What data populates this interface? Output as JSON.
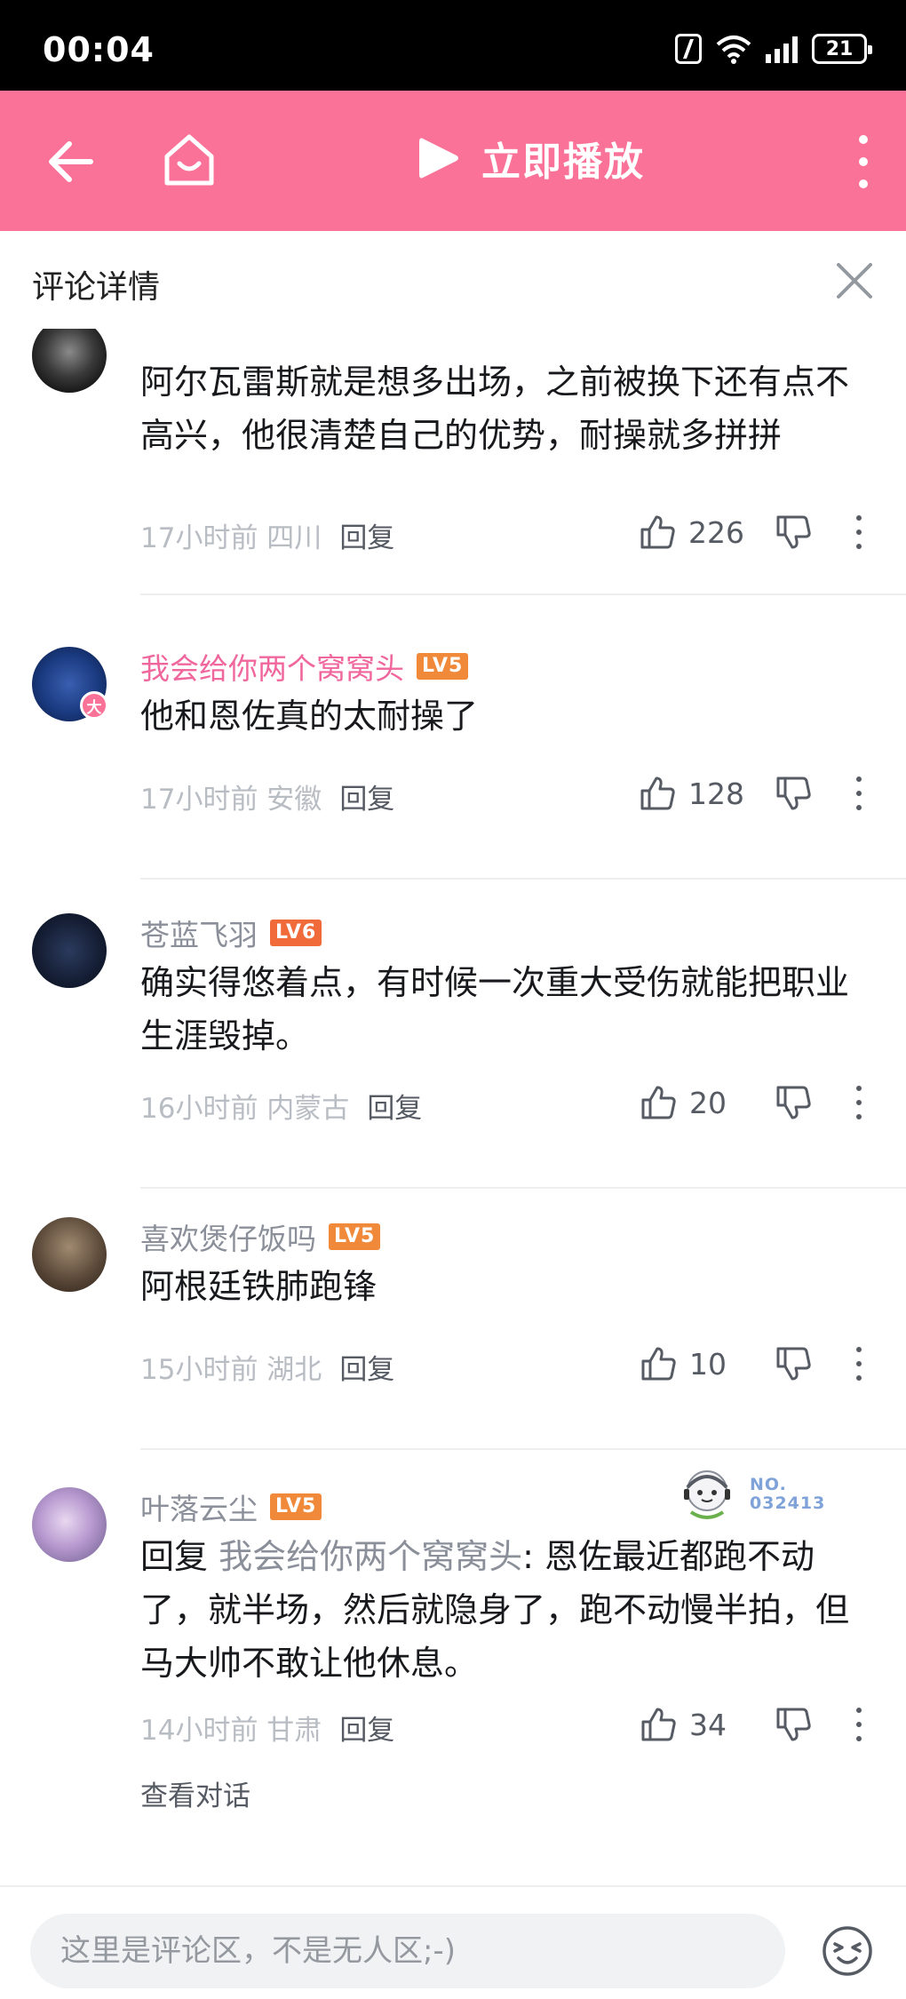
{
  "status_bar": {
    "time": "00:04",
    "battery": "21"
  },
  "header": {
    "play_now": "立即播放"
  },
  "panel": {
    "title": "评论详情"
  },
  "comments": [
    {
      "username": "",
      "text": "阿尔瓦雷斯就是想多出场，之前被换下还有点不高兴，他很清楚自己的优势，耐操就多拼拼",
      "time_loc": "17小时前 四川",
      "reply": "回复",
      "likes": "226"
    },
    {
      "username": "我会给你两个窝窝头",
      "level": "LV5",
      "fan_badge": "大",
      "text": "他和恩佐真的太耐操了",
      "time_loc": "17小时前 安徽",
      "reply": "回复",
      "likes": "128"
    },
    {
      "username": "苍蓝飞羽",
      "level": "LV6",
      "text": "确实得悠着点，有时候一次重大受伤就能把职业生涯毁掉。",
      "time_loc": "16小时前 内蒙古",
      "reply": "回复",
      "likes": "20"
    },
    {
      "username": "喜欢煲仔饭吗",
      "level": "LV5",
      "text": "阿根廷铁肺跑锋",
      "time_loc": "15小时前 湖北",
      "reply": "回复",
      "likes": "10"
    },
    {
      "username": "叶落云尘",
      "level": "LV5",
      "no_card": [
        "NO.",
        "032413"
      ],
      "reply_prefix": "回复 ",
      "reply_to": "我会给你两个窝窝头",
      "text": ": 恩佐最近都跑不动了，就半场，然后就隐身了，跑不动慢半拍，但马大帅不敢让他休息。",
      "time_loc": "14小时前 甘肃",
      "reply": "回复",
      "likes": "34",
      "view_thread": "查看对话"
    }
  ],
  "bottom": {
    "placeholder": "这里是评论区，不是无人区;-)"
  },
  "colors": {
    "brand_pink": "#fb7299",
    "username_gray": "#8a8f99",
    "level_orange": "#f08a3a"
  }
}
